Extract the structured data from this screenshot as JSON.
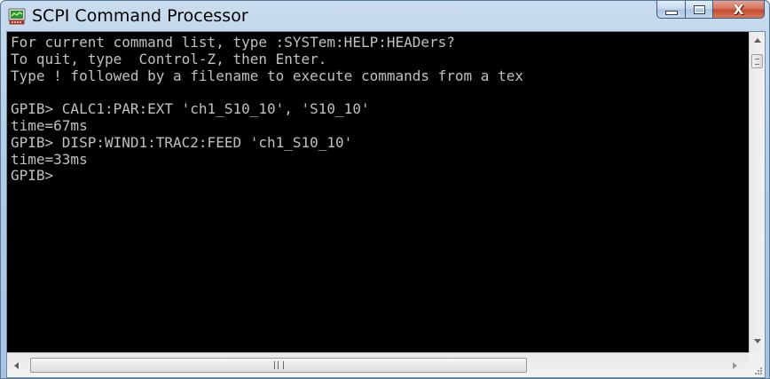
{
  "window": {
    "title": "SCPI Command Processor",
    "icon": "scpi-app-icon",
    "controls": {
      "minimize_icon": "minimize-icon",
      "maximize_icon": "maximize-icon",
      "close_glyph": "X"
    }
  },
  "console": {
    "text_color": "#c0c0c0",
    "background_color": "#000000",
    "lines": [
      "For current command list, type :SYSTem:HELP:HEADers?",
      "To quit, type  Control-Z, then Enter.",
      "Type ! followed by a filename to execute commands from a tex",
      "",
      "GPIB> CALC1:PAR:EXT 'ch1_S10_10', 'S10_10'",
      "time=67ms",
      "GPIB> DISP:WIND1:TRAC2:FEED 'ch1_S10_10'",
      "time=33ms",
      "GPIB>"
    ]
  },
  "scrollbars": {
    "horizontal_grip": "III"
  }
}
